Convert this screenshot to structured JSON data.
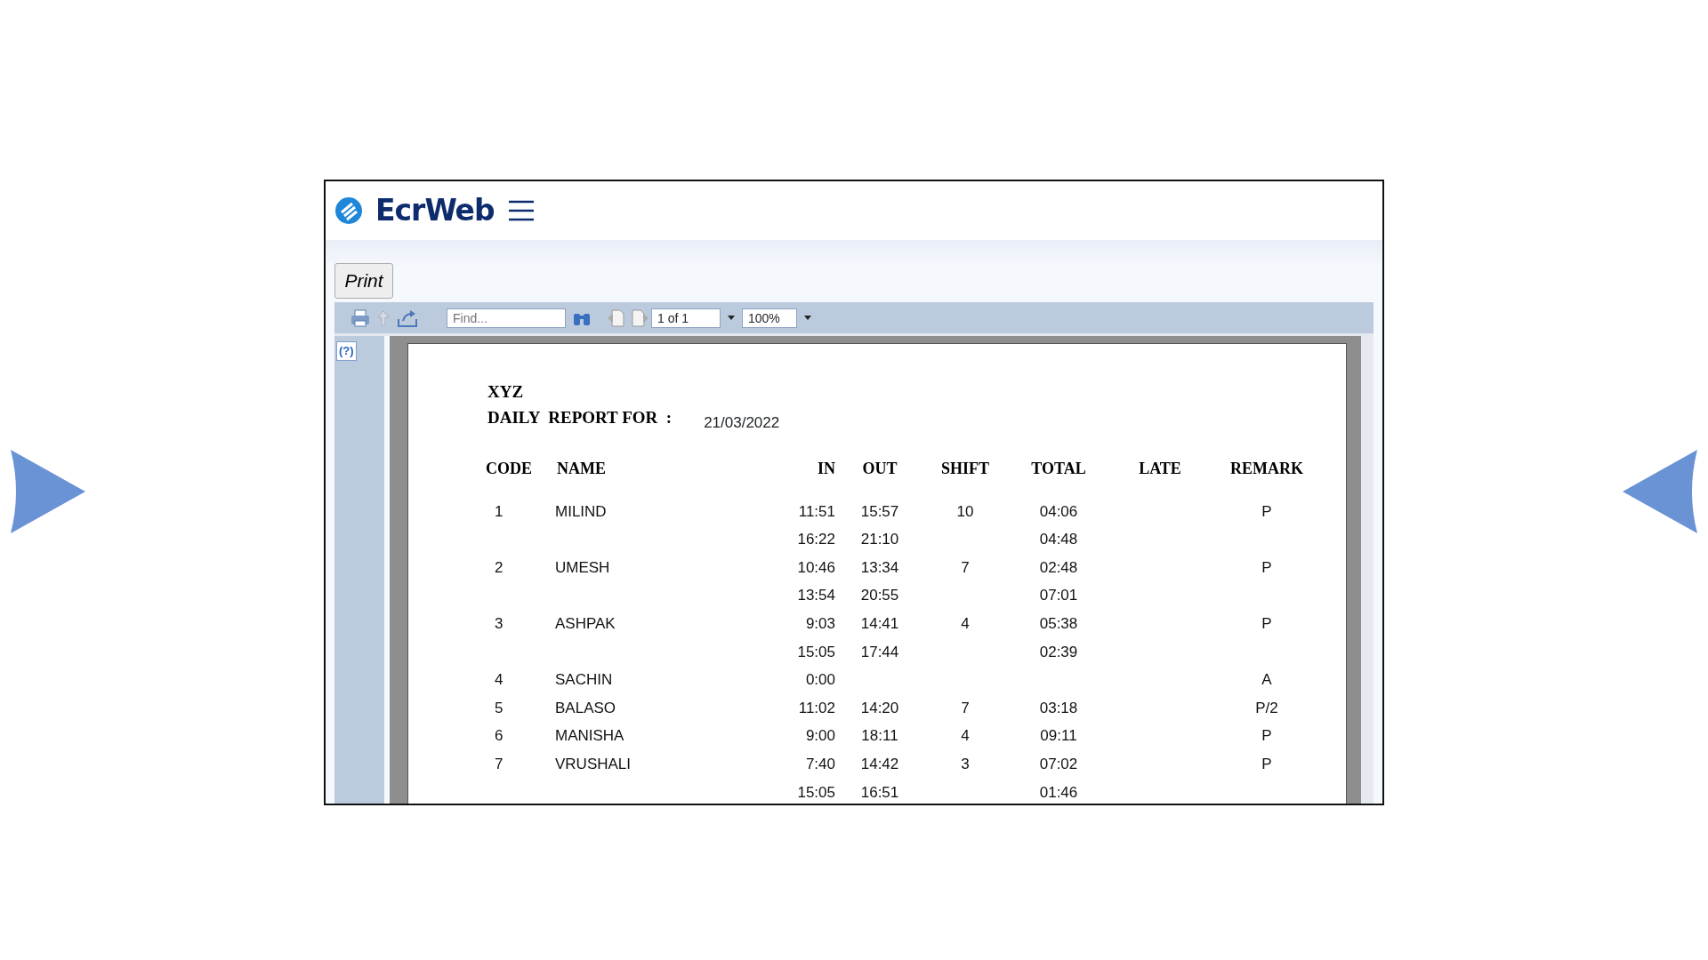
{
  "app": {
    "brand": "EcrWeb"
  },
  "print_button": "Print",
  "toolbar": {
    "find_placeholder": "Find...",
    "page": "1 of 1",
    "zoom": "100%"
  },
  "help_button": "(?)",
  "report": {
    "company": "XYZ",
    "title": "DAILY  REPORT FOR  :",
    "date": "21/03/2022",
    "columns": [
      "CODE",
      "NAME",
      "IN",
      "OUT",
      "SHIFT",
      "TOTAL",
      "LATE",
      "REMARK"
    ],
    "rows": [
      {
        "code": "1",
        "name": "MILIND",
        "in": "11:51",
        "out": "15:57",
        "shift": "10",
        "total": "04:06",
        "remark": "P"
      },
      {
        "in": "16:22",
        "out": "21:10",
        "total": "04:48"
      },
      {
        "code": "2",
        "name": "UMESH",
        "in": "10:46",
        "out": "13:34",
        "shift": "7",
        "total": "02:48",
        "remark": "P"
      },
      {
        "in": "13:54",
        "out": "20:55",
        "total": "07:01"
      },
      {
        "code": "3",
        "name": "ASHPAK",
        "in": "9:03",
        "out": "14:41",
        "shift": "4",
        "total": "05:38",
        "remark": "P"
      },
      {
        "in": "15:05",
        "out": "17:44",
        "total": "02:39"
      },
      {
        "code": "4",
        "name": "SACHIN",
        "in": "0:00",
        "remark": "A"
      },
      {
        "code": "5",
        "name": "BALASO",
        "in": "11:02",
        "out": "14:20",
        "shift": "7",
        "total": "03:18",
        "remark": "P/2"
      },
      {
        "code": "6",
        "name": "MANISHA",
        "in": "9:00",
        "out": "18:11",
        "shift": "4",
        "total": "09:11",
        "remark": "P"
      },
      {
        "code": "7",
        "name": "VRUSHALI",
        "in": "7:40",
        "out": "14:42",
        "shift": "3",
        "total": "07:02",
        "remark": "P"
      },
      {
        "in": "15:05",
        "out": "16:51",
        "total": "01:46"
      }
    ]
  }
}
